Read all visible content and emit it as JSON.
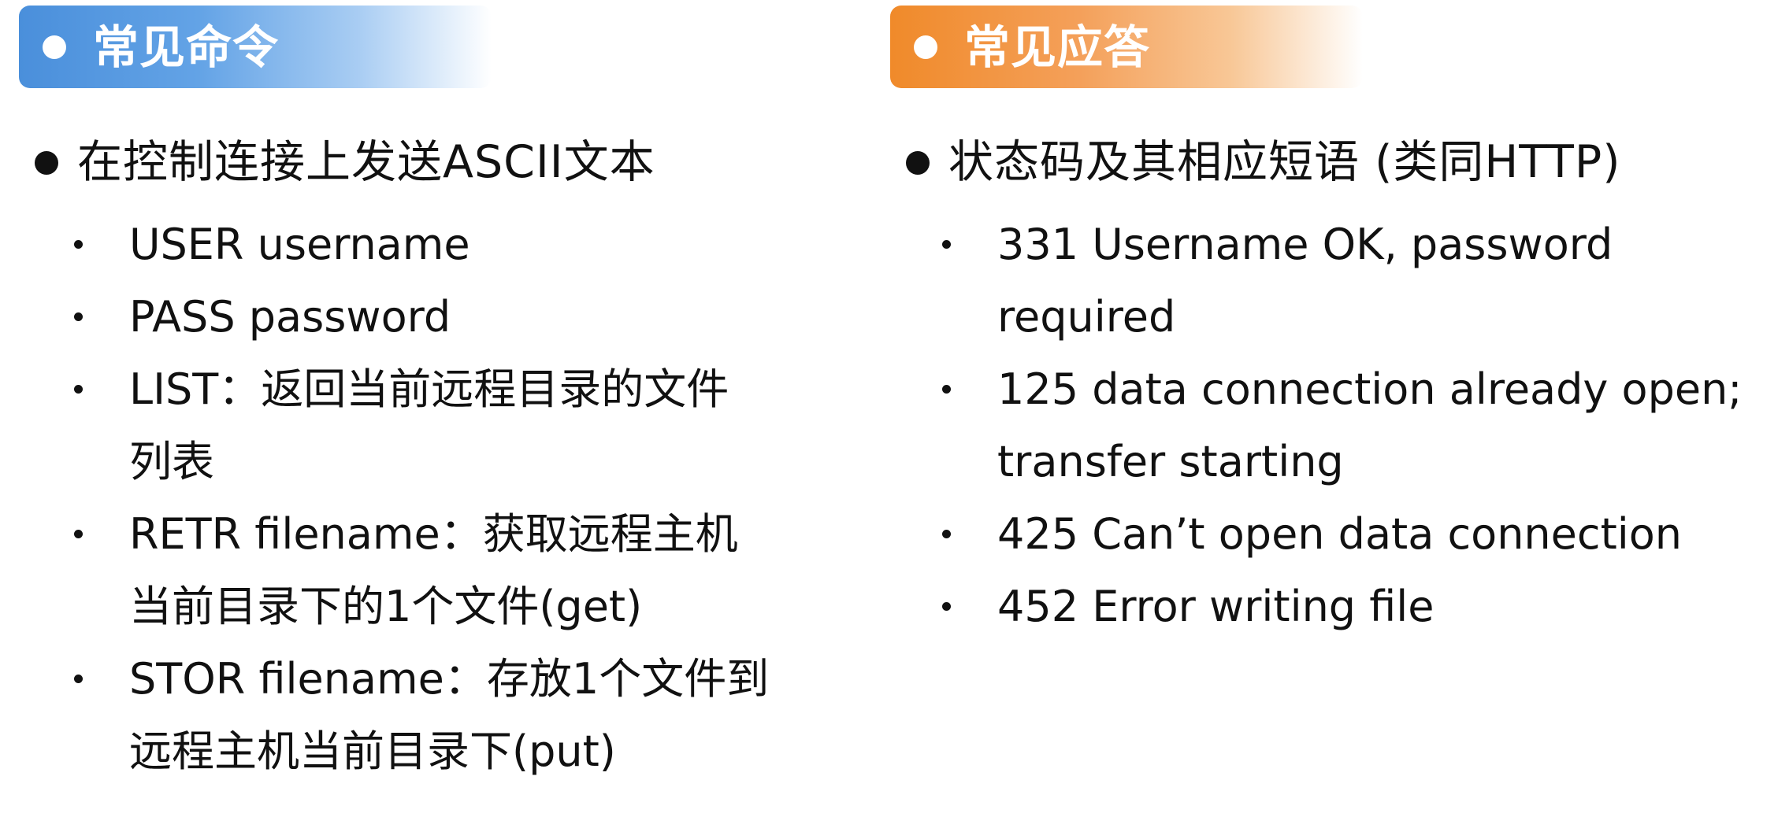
{
  "commands": {
    "header": "常见命令",
    "main_point": "在控制连接上发送ASCII文本",
    "items": [
      {
        "lines": [
          "USER username"
        ]
      },
      {
        "lines": [
          "PASS password"
        ]
      },
      {
        "lines": [
          "LIST：返回当前远程目录的文件",
          "列表"
        ]
      },
      {
        "lines": [
          "RETR filename：获取远程主机",
          "当前目录下的1个文件(get)"
        ]
      },
      {
        "lines": [
          "STOR filename：存放1个文件到",
          "远程主机当前目录下(put)"
        ]
      }
    ]
  },
  "responses": {
    "header": "常见应答",
    "main_point": "状态码及其相应短语 (类同HTTP)",
    "items": [
      {
        "lines": [
          "331 Username OK, password",
          "required"
        ]
      },
      {
        "lines": [
          "125 data connection already open;",
          "transfer starting"
        ]
      },
      {
        "lines": [
          "425 Can’t open data connection"
        ]
      },
      {
        "lines": [
          "452 Error writing file"
        ]
      }
    ]
  },
  "colors": {
    "commands_header": "#4a8fdb",
    "responses_header": "#f08a2a"
  }
}
